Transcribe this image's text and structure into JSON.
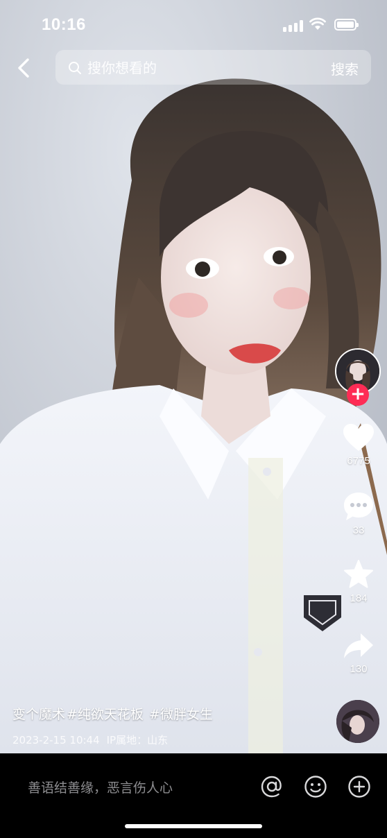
{
  "status_bar": {
    "time": "10:16"
  },
  "header": {
    "search_placeholder": "搜你想看的",
    "search_button": "搜索"
  },
  "actions": {
    "like_count": "6775",
    "comment_count": "33",
    "favorite_count": "184",
    "share_count": "130"
  },
  "caption": {
    "text": "变个魔术",
    "hashtags": [
      "#纯欲天花板",
      "#微胖女生"
    ]
  },
  "meta": {
    "date": "2023-2-15 10:44",
    "ip_location": "IP属地：山东"
  },
  "comment_bar": {
    "placeholder": "善语结善缘，恶言伤人心"
  },
  "icons": {
    "back": "chevron-left-icon",
    "search": "search-icon",
    "like": "heart-icon",
    "comment": "comment-bubble-icon",
    "favorite": "star-icon",
    "share": "share-arrow-icon",
    "mention": "at-icon",
    "emoji": "emoji-icon",
    "add": "plus-circle-icon"
  },
  "colors": {
    "accent": "#fe2c55",
    "bottom_bar": "#000000",
    "placeholder_text": "#8d8d90"
  }
}
